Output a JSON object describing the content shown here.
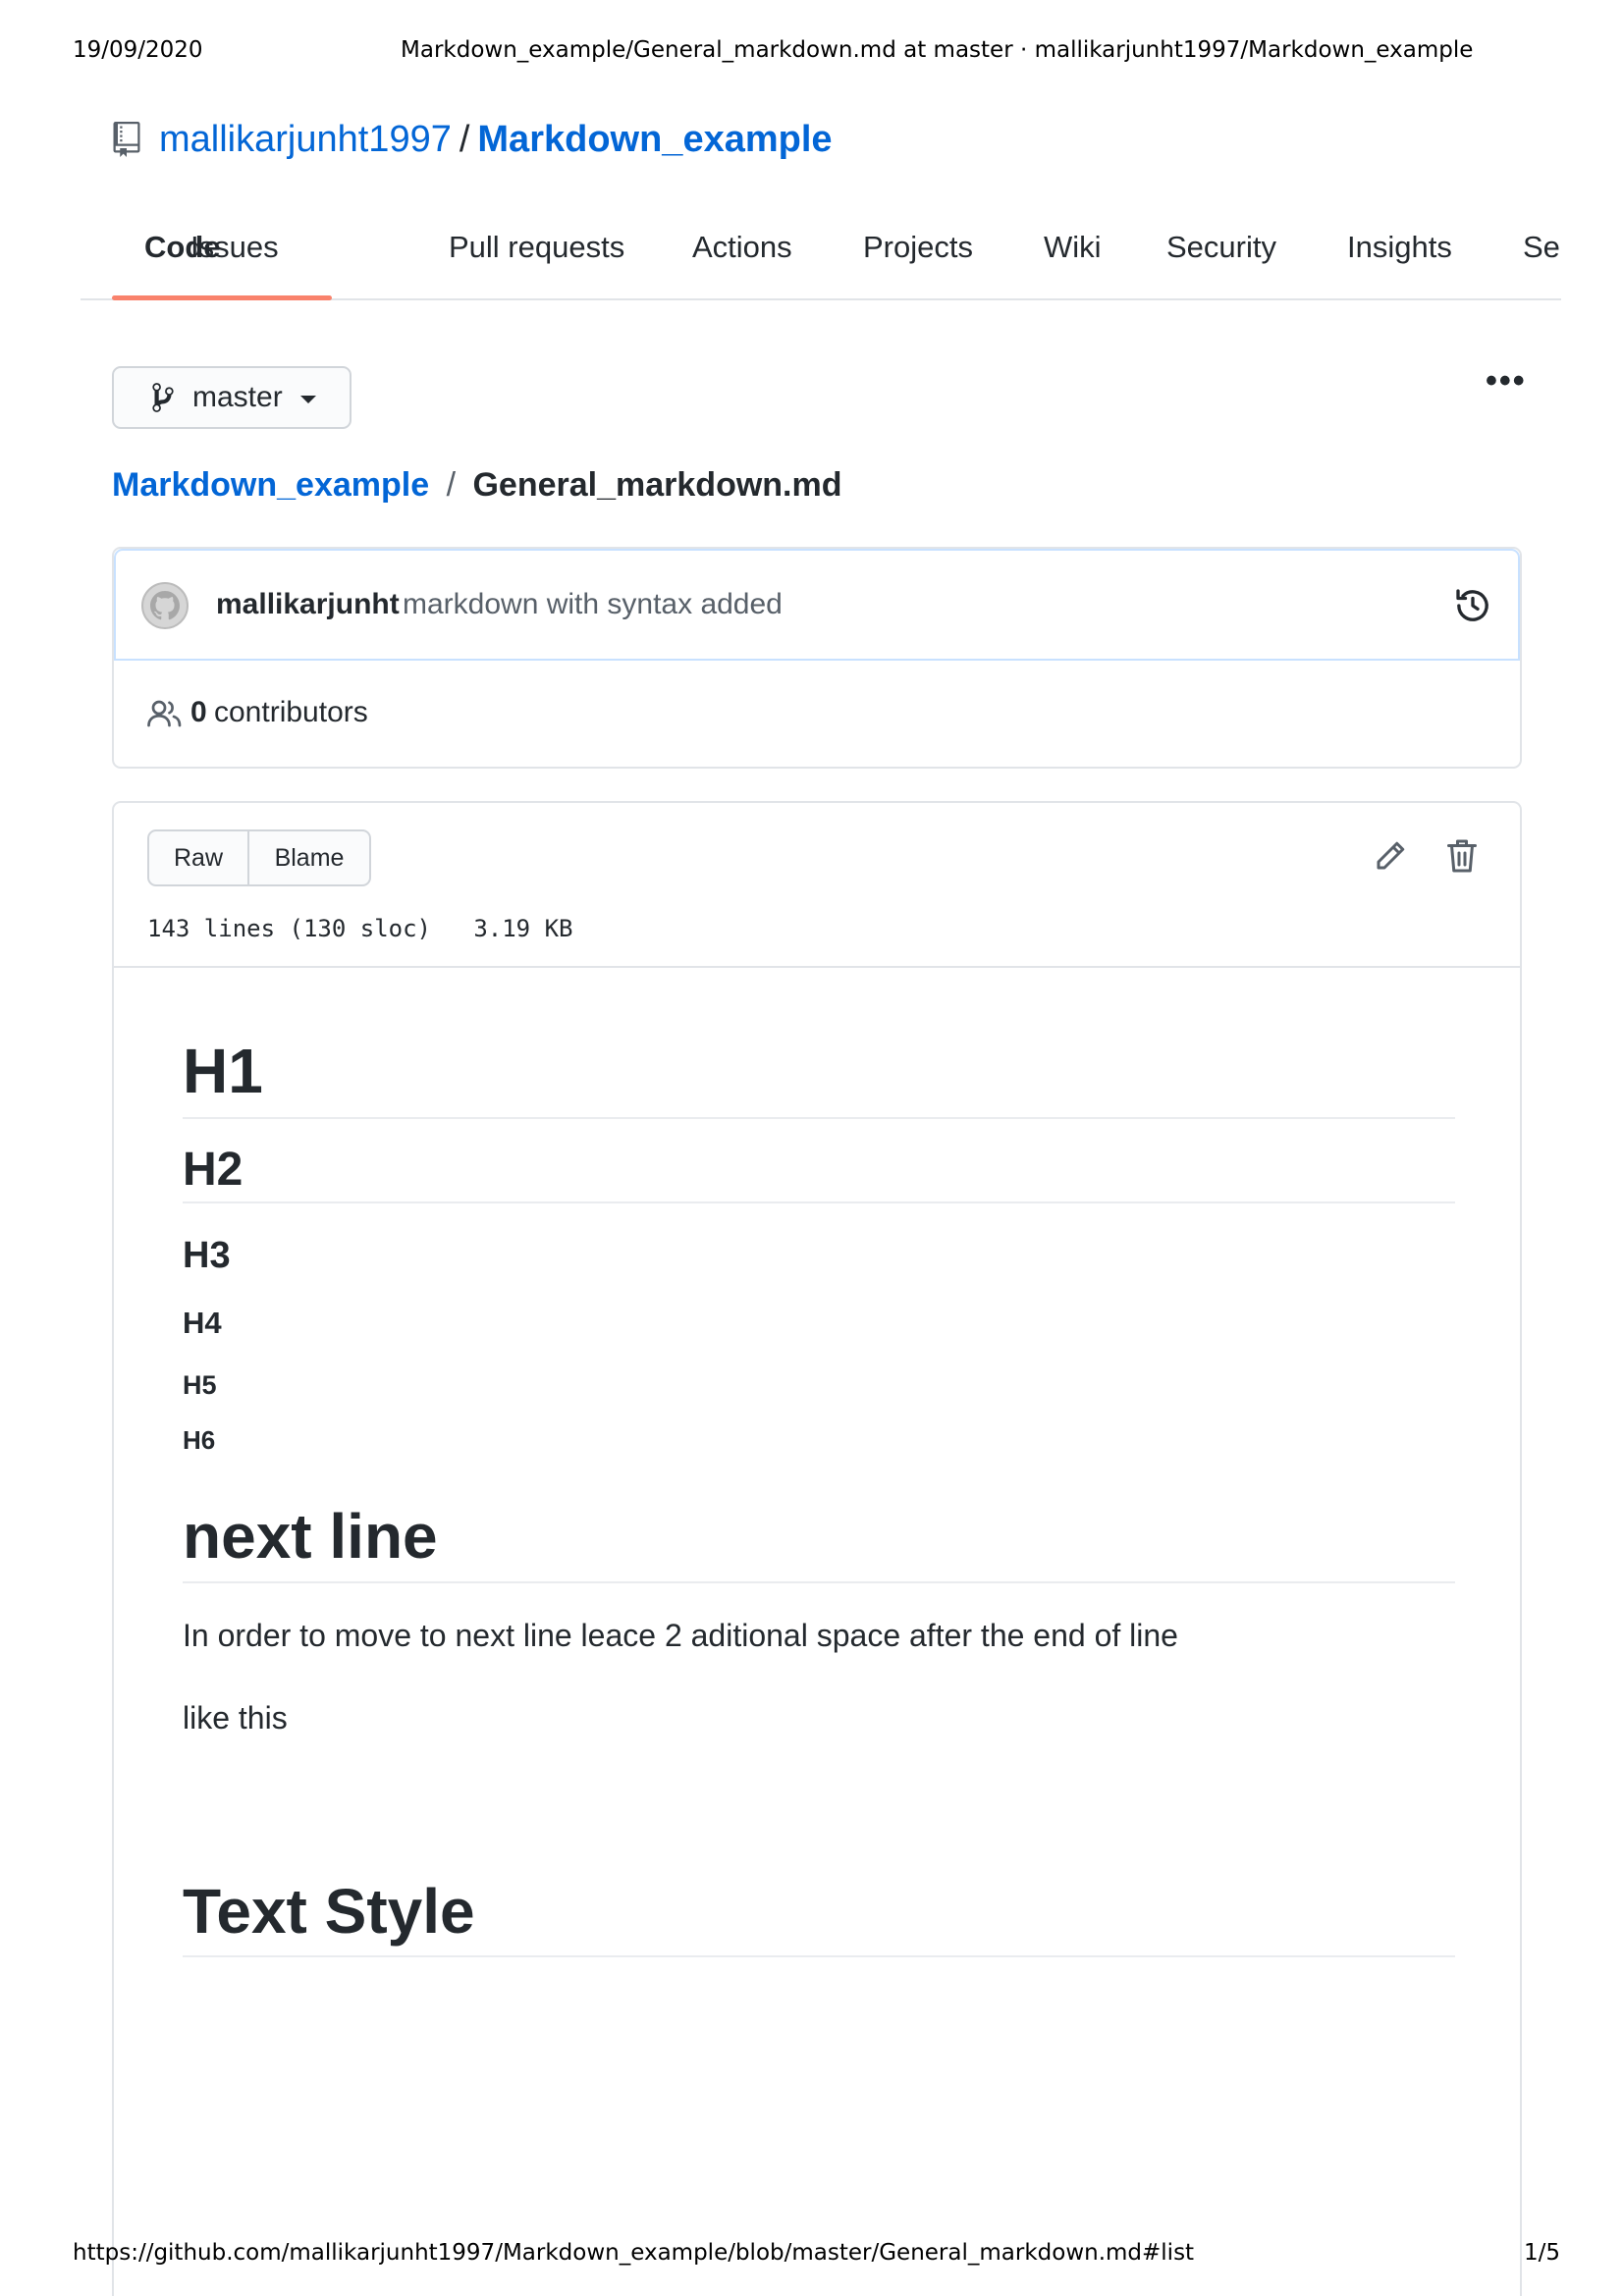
{
  "print": {
    "date": "19/09/2020",
    "title": "Markdown_example/General_markdown.md at master · mallikarjunht1997/Markdown_example",
    "url": "https://github.com/mallikarjunht1997/Markdown_example/blob/master/General_markdown.md#list",
    "page": "1/5"
  },
  "repo": {
    "owner": "mallikarjunht1997",
    "separator": "/",
    "name": "Markdown_example"
  },
  "tabs": [
    {
      "label": "Code",
      "active": true
    },
    {
      "label": "Issues"
    },
    {
      "label": "Pull requests"
    },
    {
      "label": "Actions"
    },
    {
      "label": "Projects"
    },
    {
      "label": "Wiki"
    },
    {
      "label": "Security"
    },
    {
      "label": "Insights"
    },
    {
      "label": "Se"
    }
  ],
  "branch": {
    "label": "master",
    "icon": "git-branch-icon"
  },
  "more_menu": {
    "label": "•••"
  },
  "breadcrumb": {
    "repo": "Markdown_example",
    "separator": "/",
    "file": "General_markdown.md"
  },
  "commit": {
    "author": "mallikarjunht",
    "message": "markdown with syntax added"
  },
  "contributors": {
    "count": "0",
    "label": "contributors"
  },
  "file": {
    "raw_label": "Raw",
    "blame_label": "Blame",
    "info": "143 lines (130 sloc)   3.19 KB"
  },
  "content": {
    "h1": "H1",
    "h2": "H2",
    "h3": "H3",
    "h4": "H4",
    "h5": "H5",
    "h6": "H6",
    "next_line_heading": "next line",
    "para1": "In order to move to next line leace 2 aditional space after the end of line",
    "para2": "like this",
    "text_style_heading": "Text Style"
  },
  "colors": {
    "link": "#0366d6",
    "tab_underline": "#f9826c",
    "text": "#24292e",
    "muted": "#586069"
  }
}
